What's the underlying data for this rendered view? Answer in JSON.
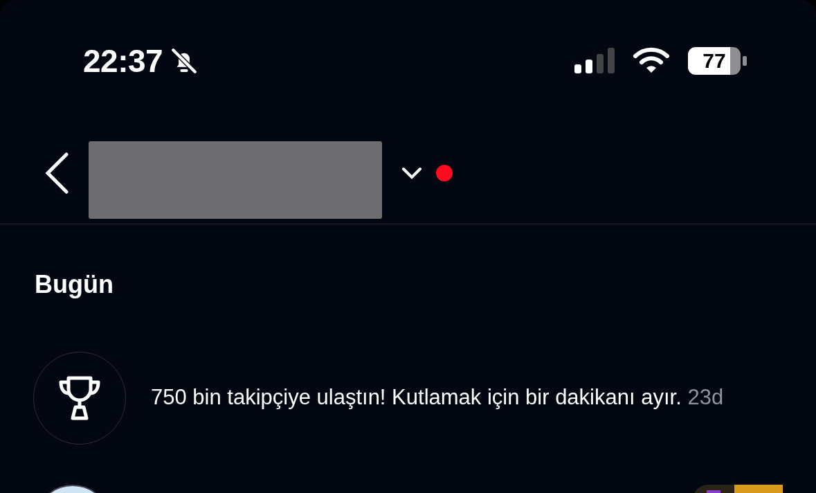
{
  "status_bar": {
    "time": "22:37",
    "battery": "77"
  },
  "header": {
    "has_unread": true
  },
  "sections": [
    {
      "title": "Bugün",
      "items": [
        {
          "kind": "milestone",
          "text": "750 bin takipçiye ulaştın! Kutlamak için bir dakikanı ayır.",
          "time": "23d"
        }
      ]
    }
  ],
  "next_row": {
    "kind": "partial"
  }
}
